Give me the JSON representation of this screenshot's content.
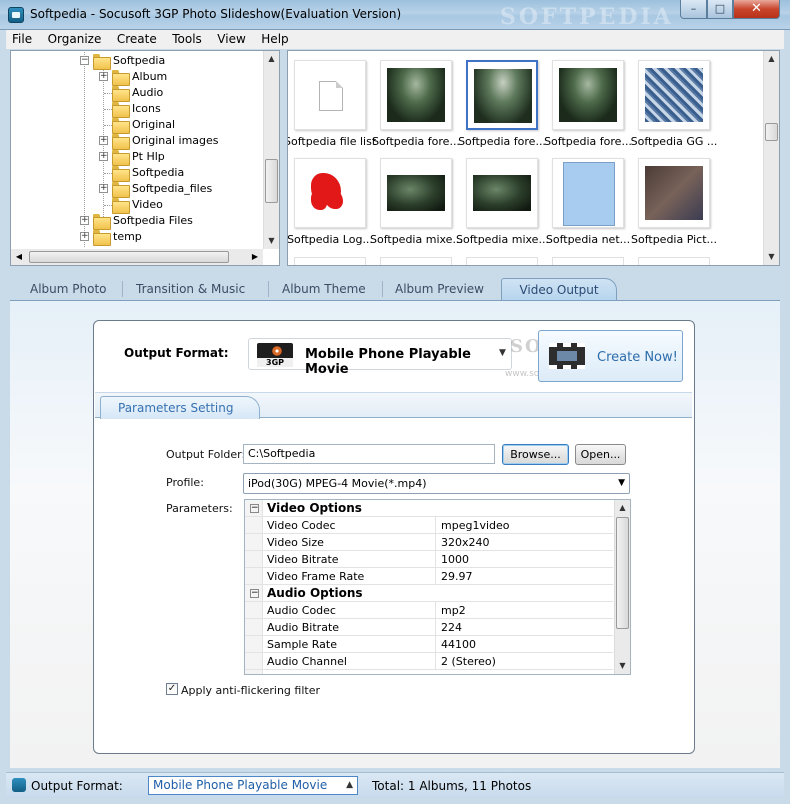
{
  "window": {
    "title": "Softpedia - Socusoft 3GP Photo Slideshow(Evaluation Version)",
    "watermark": "SOFTPEDIA",
    "min_glyph": "–",
    "max_glyph": "□",
    "close_glyph": "✕"
  },
  "menu": [
    "File",
    "Organize",
    "Create",
    "Tools",
    "View",
    "Help"
  ],
  "tree": {
    "items": [
      {
        "label": "Softpedia",
        "expander": "−"
      },
      {
        "label": "Album",
        "expander": "+"
      },
      {
        "label": "Audio",
        "expander": ""
      },
      {
        "label": "Icons",
        "expander": ""
      },
      {
        "label": "Original",
        "expander": ""
      },
      {
        "label": "Original images",
        "expander": "+"
      },
      {
        "label": "Pt Hlp",
        "expander": "+"
      },
      {
        "label": "Softpedia",
        "expander": ""
      },
      {
        "label": "Softpedia_files",
        "expander": "+"
      },
      {
        "label": "Video",
        "expander": ""
      },
      {
        "label": "Softpedia Files",
        "expander": "+"
      },
      {
        "label": "temp",
        "expander": "+"
      }
    ]
  },
  "thumbnails": [
    {
      "caption": "Softpedia file list",
      "kind": "file-icon"
    },
    {
      "caption": "Softpedia fore...",
      "kind": "forest"
    },
    {
      "caption": "Softpedia fore...",
      "kind": "forest2",
      "selected": true
    },
    {
      "caption": "Softpedia fore...",
      "kind": "forest"
    },
    {
      "caption": "Softpedia GG ...",
      "kind": "gg"
    },
    {
      "caption": "Softpedia Log...",
      "kind": "red-blob"
    },
    {
      "caption": "Softpedia mixe...",
      "kind": "forest-small"
    },
    {
      "caption": "Softpedia mixe...",
      "kind": "forest-small"
    },
    {
      "caption": "Softpedia net...",
      "kind": "net"
    },
    {
      "caption": "Softpedia Pict...",
      "kind": "pict"
    }
  ],
  "tabs": [
    "Album Photo",
    "Transition & Music",
    "Album Theme",
    "Album Preview",
    "Video Output"
  ],
  "active_tab": "Video Output",
  "output": {
    "label": "Output Format:",
    "format": "Mobile Phone Playable Movie",
    "badge": "3GP",
    "create_label": "Create Now!",
    "watermark": "SOFTPEDIA",
    "watermark_url": "www.softpedia.com"
  },
  "parameters_tab": "Parameters Setting",
  "form": {
    "folder_label": "Output Folder:",
    "folder_value": "C:\\Softpedia",
    "browse": "Browse...",
    "open": "Open...",
    "profile_label": "Profile:",
    "profile_value": "iPod(30G) MPEG-4 Movie(*.mp4)",
    "params_label": "Parameters:",
    "anti_flicker": "Apply anti-flickering filter",
    "anti_flicker_checked": true
  },
  "params_grid": [
    {
      "section": "Video Options"
    },
    {
      "key": "Video Codec",
      "value": "mpeg1video"
    },
    {
      "key": "Video Size",
      "value": "320x240"
    },
    {
      "key": "Video Bitrate",
      "value": "1000"
    },
    {
      "key": "Video Frame Rate",
      "value": "29.97"
    },
    {
      "section": "Audio Options"
    },
    {
      "key": "Audio Codec",
      "value": "mp2"
    },
    {
      "key": "Audio Bitrate",
      "value": "224"
    },
    {
      "key": "Sample Rate",
      "value": "44100"
    },
    {
      "key": "Audio Channel",
      "value": "2 (Stereo)"
    }
  ],
  "status": {
    "label": "Output Format:",
    "format": "Mobile Phone Playable Movie",
    "info": "Total: 1 Albums, 11 Photos"
  },
  "colors": {
    "accent": "#3772b1",
    "frame": "#c9dbe9",
    "active_tab": "#b7d5ee"
  }
}
